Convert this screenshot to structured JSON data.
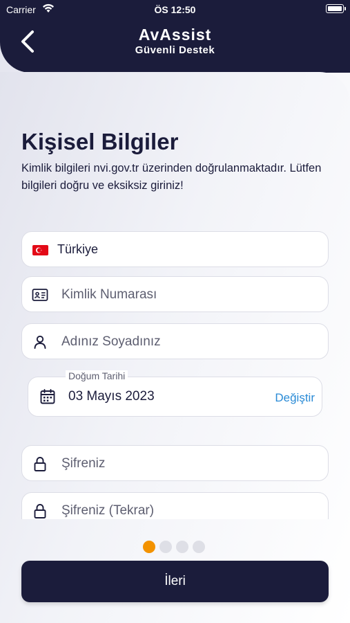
{
  "status_bar": {
    "carrier": "Carrier",
    "time": "ÖS 12:50"
  },
  "header": {
    "title": "AvAssist",
    "subtitle": "Güvenli Destek",
    "back_icon": "chevron-left-icon"
  },
  "page": {
    "title": "Kişisel Bilgiler",
    "description": "Kimlik bilgileri nvi.gov.tr üzerinden doğrulanmaktadır. Lütfen bilgileri doğru ve eksiksiz giriniz!"
  },
  "form": {
    "country": {
      "value": "Türkiye",
      "icon": "turkey-flag-icon"
    },
    "id_number": {
      "placeholder": "Kimlik Numarası",
      "icon": "id-card-icon"
    },
    "full_name": {
      "placeholder": "Adınız Soyadınız",
      "icon": "user-icon"
    },
    "birth_date": {
      "label": "Doğum Tarihi",
      "value": "03 Mayıs 2023",
      "action": "Değiştir",
      "icon": "calendar-icon"
    },
    "password": {
      "placeholder": "Şifreniz",
      "icon": "lock-icon"
    },
    "password_repeat": {
      "placeholder": "Şifreniz (Tekrar)",
      "icon": "lock-icon"
    }
  },
  "pager": {
    "total": 4,
    "active": 1,
    "active_color": "#f39200",
    "inactive_color": "#dedfe6"
  },
  "next_button": {
    "label": "İleri"
  },
  "colors": {
    "primary": "#1b1c3b",
    "accent": "#2a8bd6"
  }
}
